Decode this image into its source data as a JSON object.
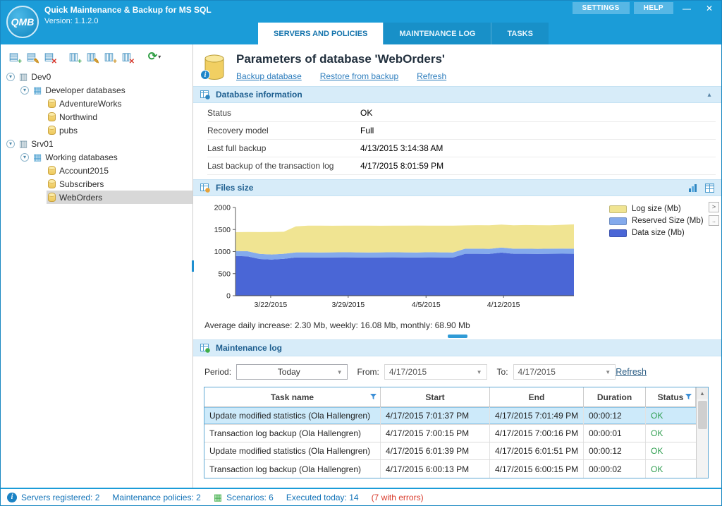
{
  "app": {
    "logo_text": "QMB",
    "title": "Quick Maintenance & Backup for MS SQL",
    "version": "Version: 1.1.2.0",
    "settings_button": "SETTINGS",
    "help_button": "HELP",
    "minimize_glyph": "—",
    "close_glyph": "✕"
  },
  "colors": {
    "titlebar": "#1b9cd8",
    "accent": "#1272ab",
    "section_header_bg": "#d7ecf9",
    "section_header_text": "#1d5e8f",
    "selected_row_bg": "#cdeafa",
    "ok_green": "#2e9e4f",
    "error_red": "#d93a2b"
  },
  "tabs": [
    {
      "label": "SERVERS AND POLICIES",
      "active": true
    },
    {
      "label": "MAINTENANCE LOG",
      "active": false
    },
    {
      "label": "TASKS",
      "active": false
    }
  ],
  "sidebar": {
    "toolbar": [
      {
        "name": "add-server-button",
        "base": "▤",
        "badge": "+",
        "badge_color": "#2f9e44",
        "gap_after": false
      },
      {
        "name": "edit-server-button",
        "base": "▤",
        "badge": "✎",
        "badge_color": "#c7860a",
        "gap_after": false
      },
      {
        "name": "delete-server-button",
        "base": "▤",
        "badge": "✕",
        "badge_color": "#d7362a",
        "gap_after": true
      },
      {
        "name": "add-database-group-button",
        "base": "▥",
        "badge": "+",
        "badge_color": "#2f9e44",
        "gap_after": false
      },
      {
        "name": "edit-database-group-button",
        "base": "▥",
        "badge": "✎",
        "badge_color": "#c7860a",
        "gap_after": false
      },
      {
        "name": "add-database-button",
        "base": "▥",
        "badge": "+",
        "badge_color": "#c7860a",
        "gap_after": false
      },
      {
        "name": "delete-database-button",
        "base": "▥",
        "badge": "✕",
        "badge_color": "#d7362a",
        "gap_after": true
      }
    ],
    "refresh_button": {
      "glyph": "⟳",
      "caret": "▾"
    },
    "tree": [
      {
        "label": "Dev0",
        "level": 0,
        "type": "server",
        "expander": true,
        "selected": false
      },
      {
        "label": "Developer databases",
        "level": 1,
        "type": "group",
        "expander": true,
        "selected": false
      },
      {
        "label": "AdventureWorks",
        "level": 2,
        "type": "database",
        "expander": false,
        "selected": false
      },
      {
        "label": "Northwind",
        "level": 2,
        "type": "database",
        "expander": false,
        "selected": false
      },
      {
        "label": "pubs",
        "level": 2,
        "type": "database",
        "expander": false,
        "selected": false
      },
      {
        "label": "Srv01",
        "level": 0,
        "type": "server",
        "expander": true,
        "selected": false
      },
      {
        "label": "Working databases",
        "level": 1,
        "type": "group",
        "expander": true,
        "selected": false
      },
      {
        "label": "Account2015",
        "level": 2,
        "type": "database",
        "expander": false,
        "selected": false
      },
      {
        "label": "Subscribers",
        "level": 2,
        "type": "database",
        "expander": false,
        "selected": false
      },
      {
        "label": "WebOrders",
        "level": 2,
        "type": "database",
        "expander": false,
        "selected": true
      }
    ]
  },
  "content": {
    "page_title": "Parameters of database 'WebOrders'",
    "links": [
      {
        "label": "Backup database"
      },
      {
        "label": "Restore from backup"
      },
      {
        "label": "Refresh"
      }
    ],
    "database_information": {
      "title": "Database information",
      "collapse_glyph": "▴",
      "rows": [
        {
          "label": "Status",
          "value": "OK"
        },
        {
          "label": "Recovery model",
          "value": "Full"
        },
        {
          "label": "Last full backup",
          "value": "4/13/2015 3:14:38 AM"
        },
        {
          "label": "Last backup of the transaction log",
          "value": "4/17/2015 8:01:59 PM"
        }
      ]
    },
    "files_size": {
      "title": "Files size",
      "side_button_next": ">",
      "side_button_more": "..",
      "average_line": "Average daily increase: 2.30 Mb, weekly: 16.08 Mb, monthly: 68.90 Mb"
    },
    "maintenance_log": {
      "title": "Maintenance log",
      "period_label": "Period:",
      "period_value": "Today",
      "from_label": "From:",
      "from_value": "4/17/2015",
      "to_label": "To:",
      "to_value": "4/17/2015",
      "refresh_label": "Refresh",
      "table": {
        "columns": [
          {
            "label": "Task name",
            "filter": true
          },
          {
            "label": "Start",
            "filter": false
          },
          {
            "label": "End",
            "filter": false
          },
          {
            "label": "Duration",
            "filter": false
          },
          {
            "label": "Status",
            "filter": true
          }
        ],
        "rows": [
          {
            "task": "Update modified statistics (Ola Hallengren)",
            "start": "4/17/2015 7:01:37 PM",
            "end": "4/17/2015 7:01:49 PM",
            "duration": "00:00:12",
            "status": "OK",
            "selected": true
          },
          {
            "task": "Transaction log backup (Ola Hallengren)",
            "start": "4/17/2015 7:00:15 PM",
            "end": "4/17/2015 7:00:16 PM",
            "duration": "00:00:01",
            "status": "OK",
            "selected": false
          },
          {
            "task": "Update modified statistics (Ola Hallengren)",
            "start": "4/17/2015 6:01:39 PM",
            "end": "4/17/2015 6:01:51 PM",
            "duration": "00:00:12",
            "status": "OK",
            "selected": false
          },
          {
            "task": "Transaction log backup (Ola Hallengren)",
            "start": "4/17/2015 6:00:13 PM",
            "end": "4/17/2015 6:00:15 PM",
            "duration": "00:00:02",
            "status": "OK",
            "selected": false
          }
        ]
      }
    }
  },
  "chart_data": {
    "type": "area",
    "stacked": true,
    "title": "",
    "xlabel": "",
    "ylabel": "",
    "ylim": [
      0,
      2000
    ],
    "y_ticks": [
      0,
      500,
      1000,
      1500,
      2000
    ],
    "x_tick_labels": [
      "3/22/2015",
      "3/29/2015",
      "4/5/2015",
      "4/12/2015"
    ],
    "x_tick_positions": [
      0.104,
      0.333,
      0.563,
      0.792
    ],
    "grid": false,
    "legend_position": "right",
    "legend": [
      {
        "label": "Log size (Mb)",
        "color": "#f0e492"
      },
      {
        "label": "Reserved Size (Mb)",
        "color": "#84aaec"
      },
      {
        "label": "Data size (Mb)",
        "color": "#4a66d6"
      }
    ],
    "series": [
      {
        "name": "Data size (Mb)",
        "color": "#4a66d6",
        "values": [
          900,
          893,
          832,
          820,
          836,
          868,
          868,
          866,
          868,
          870,
          868,
          866,
          868,
          870,
          868,
          866,
          870,
          868,
          866,
          950,
          950,
          948,
          978,
          950,
          950,
          948,
          950,
          952,
          950
        ]
      },
      {
        "name": "Reserved Size (Mb)",
        "color": "#84aaec",
        "values": [
          115,
          115,
          115,
          115,
          115,
          115,
          115,
          115,
          115,
          115,
          115,
          115,
          115,
          115,
          115,
          115,
          115,
          115,
          115,
          115,
          115,
          115,
          115,
          115,
          115,
          115,
          115,
          115,
          115
        ]
      },
      {
        "name": "Log size (Mb)",
        "color": "#f0e492",
        "values": [
          425,
          436,
          494,
          510,
          498,
          590,
          606,
          606,
          602,
          602,
          606,
          606,
          602,
          602,
          606,
          610,
          604,
          604,
          608,
          528,
          534,
          534,
          518,
          532,
          536,
          536,
          532,
          540,
          552
        ]
      }
    ]
  },
  "statusbar": {
    "items": [
      {
        "icon": "info-icon",
        "label": "Servers registered: 2",
        "error": false
      },
      {
        "icon": null,
        "label": "Maintenance policies: 2",
        "error": false
      },
      {
        "icon": "scenarios-icon",
        "label": "Scenarios: 6",
        "error": false
      },
      {
        "icon": null,
        "label": "Executed today: 14",
        "error": false
      },
      {
        "icon": null,
        "label": "(7 with errors)",
        "error": true
      }
    ]
  }
}
